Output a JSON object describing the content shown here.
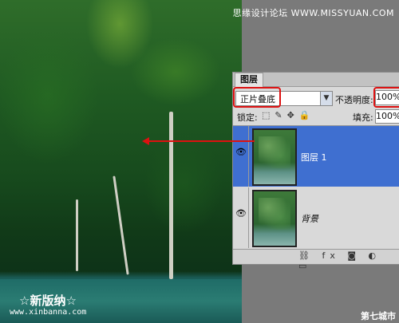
{
  "watermark": "思缘设计论坛 WWW.MISSYUAN.COM",
  "panel": {
    "tab": "图层",
    "blend_mode": "正片叠底",
    "opacity_label": "不透明度:",
    "opacity_value": "100%",
    "lock_label": "锁定:",
    "fill_label": "填充:",
    "fill_value": "100%",
    "layers": [
      {
        "name": "图层 1",
        "selected": true
      },
      {
        "name": "背景",
        "selected": false
      }
    ]
  },
  "icons": {
    "dropdown": "chevron-down-icon",
    "eye": "eye-icon",
    "link": "link-icon",
    "fx": "fx-icon",
    "mask": "mask-icon",
    "adjustment": "adjustment-icon",
    "new_layer": "new-layer-icon"
  },
  "colors": {
    "selected_layer": "#3f6fd0",
    "highlight": "#dd1111"
  },
  "footer": {
    "logo": "☆新版纳☆",
    "url": "www.xinbanna.com",
    "site2": "第七城市"
  }
}
